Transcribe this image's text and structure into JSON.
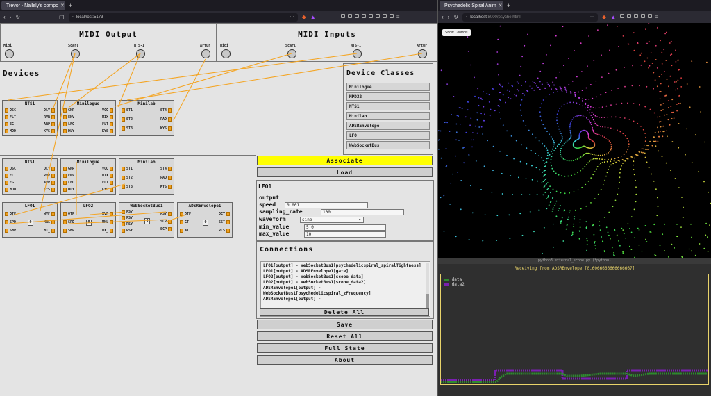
{
  "browser_left": {
    "tab": "Trevor - Nallely's compo",
    "url": "localhost:5173"
  },
  "browser_right": {
    "tab": "Psychedelic Spiral Anim",
    "url_host": "localhost",
    "url_rest": ":8000/psyche.html"
  },
  "midi_output": {
    "title": "MIDI Output",
    "ports": [
      "Midi",
      "Scarl",
      "NTS-1",
      "Artur"
    ]
  },
  "midi_inputs": {
    "title": "MIDI Inputs",
    "ports": [
      "Midi",
      "Scarl",
      "NTS-1",
      "Artur"
    ]
  },
  "devices": {
    "title": "Devices",
    "items": [
      {
        "name": "NTS1",
        "left": [
          "OSC",
          "FLT",
          "EG",
          "MOD"
        ],
        "right": [
          "DLY",
          "RVR",
          "ARP",
          "KYS"
        ]
      },
      {
        "name": "Minilogue",
        "left": [
          "GNR",
          "ENV",
          "LFO",
          "DLY"
        ],
        "right": [
          "VCO",
          "MIX",
          "FLT",
          "KYS"
        ]
      },
      {
        "name": "Minilab",
        "left": [
          "ST1",
          "ST2",
          "ST3"
        ],
        "right": [
          "ST4",
          "PAD",
          "KYS"
        ]
      }
    ]
  },
  "device_classes": {
    "title": "Device Classes",
    "items": [
      "Minilogue",
      "MPD32",
      "NTS1",
      "Minilab",
      "ADSREnvelope",
      "LFO",
      "WebSocketBus"
    ]
  },
  "virtual": {
    "items": [
      {
        "name": "LFO1",
        "left": [
          "OTP",
          "SPD",
          "SMP"
        ],
        "mid": "0",
        "right": [
          "WVF",
          "MNL",
          "MX_"
        ]
      },
      {
        "name": "LFO2",
        "left": [
          "OTP",
          "SPD",
          "SMP"
        ],
        "mid": "0",
        "right": [
          "WVF",
          "MNL",
          "MX_"
        ]
      },
      {
        "name": "WebSocketBus1",
        "left": [
          "PSY",
          "PSY",
          "PSY",
          "PSY"
        ],
        "mid": "0",
        "right": [
          "PSY",
          "SCP",
          "SCP"
        ]
      },
      {
        "name": "ADSREnvelope1",
        "left": [
          "OTP",
          "GT",
          "ATT"
        ],
        "mid": "0",
        "right": [
          "DCY",
          "SST",
          "RLS"
        ]
      }
    ]
  },
  "buttons": {
    "associate": "Associate",
    "load": "Load",
    "delete_all": "Delete All",
    "save": "Save",
    "reset_all": "Reset All",
    "full_state": "Full State",
    "about": "About"
  },
  "details": {
    "title": "LFO1",
    "output": "output",
    "speed_label": "speed",
    "speed": "0.001",
    "sampling_label": "sampling_rate",
    "sampling": "100",
    "waveform_label": "waveform",
    "waveform": "sine",
    "min_label": "min_value",
    "min": "5.0",
    "max_label": "max_value",
    "max": "10"
  },
  "connections": {
    "title": "Connections",
    "items": [
      "LFO1[output] - WebSocketBus1[psychedelicspiral_spiralTightness]",
      "LFO1[output] - ADSREnvelope1[gate]",
      "LFO2[output] - WebSocketBus1[scope_data]",
      "LFO2[output] - WebSocketBus1[scope_data2]",
      "ADSREnvelope1[output] - WebSocketBus1[psychedelicspiral_zFrequency]",
      "ADSREnvelope1[output] -"
    ]
  },
  "spiral": {
    "show_controls": "Show Controls"
  },
  "scope": {
    "bar": "python3 external_scope.py (*python)",
    "title": "Receiving from ADSREnvelope [0.6066666666666667]",
    "legend": [
      "data",
      "data2"
    ],
    "colors": [
      "#2e8b2e",
      "#7a1fb0"
    ]
  }
}
